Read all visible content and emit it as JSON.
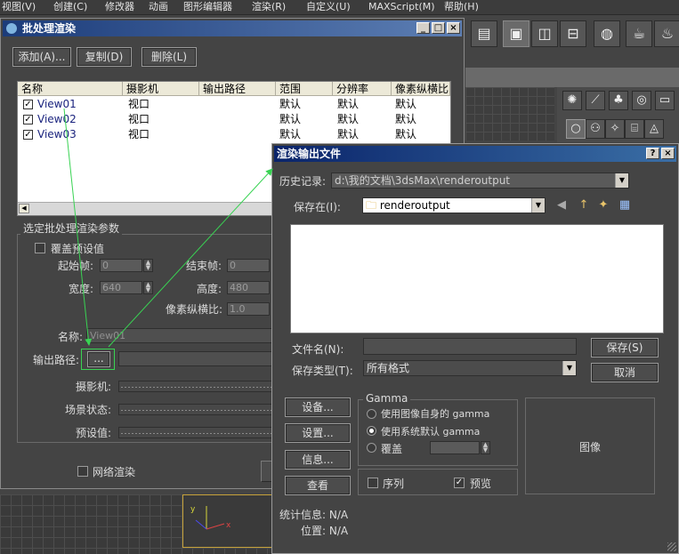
{
  "menubar": {
    "items": [
      "视图(V)",
      "创建(C)",
      "修改器",
      "动画",
      "图形编辑器",
      "渲染(R)",
      "自定义(U)",
      "MAXScript(M)",
      "帮助(H)"
    ]
  },
  "batch": {
    "title": "批处理渲染",
    "add_label": "添加(A)...",
    "copy_label": "复制(D)",
    "delete_label": "删除(L)",
    "columns": [
      "名称",
      "摄影机",
      "输出路径",
      "范围",
      "分辨率",
      "像素纵横比"
    ],
    "rows": [
      {
        "name": "View01",
        "camera": "视口",
        "path": "",
        "range": "默认",
        "resolution": "默认",
        "aspect": "默认"
      },
      {
        "name": "View02",
        "camera": "视口",
        "path": "",
        "range": "默认",
        "resolution": "默认",
        "aspect": "默认"
      },
      {
        "name": "View03",
        "camera": "视口",
        "path": "",
        "range": "默认",
        "resolution": "默认",
        "aspect": "默认"
      }
    ],
    "params_group": "选定批处理渲染参数",
    "override_label": "覆盖预设值",
    "start_frame_label": "起始帧:",
    "start_frame_value": "0",
    "end_frame_label": "结束帧:",
    "end_frame_value": "0",
    "width_label": "宽度:",
    "width_value": "640",
    "height_label": "高度:",
    "height_value": "480",
    "pixel_aspect_label": "像素纵横比:",
    "pixel_aspect_value": "1.0",
    "name_label": "名称:",
    "name_value": "View01",
    "output_path_label": "输出路径:",
    "browse_label": "...",
    "camera_label": "摄影机:",
    "scene_state_label": "场景状态:",
    "preset_label": "预设值:",
    "net_render_label": "网络渲染"
  },
  "output": {
    "title": "渲染输出文件",
    "help_btn": "?",
    "close_btn": "×",
    "history_label": "历史记录:",
    "history_value": "d:\\我的文档\\3dsMax\\renderoutput",
    "save_in_label": "保存在(I):",
    "save_in_value": "renderoutput",
    "filename_label": "文件名(N):",
    "filename_value": "",
    "filetype_label": "保存类型(T):",
    "filetype_value": "所有格式",
    "save_label": "保存(S)",
    "cancel_label": "取消",
    "devices_label": "设备...",
    "setup_label": "设置...",
    "info_label": "信息...",
    "view_label": "查看",
    "gamma_group": "Gamma",
    "gamma_opt1": "使用图像自身的 gamma",
    "gamma_opt2": "使用系统默认 gamma",
    "gamma_opt3": "覆盖",
    "sequence_label": "序列",
    "preview_label": "预览",
    "image_label": "图像",
    "stats_label": "统计信息: N/A",
    "location_label": "位置: N/A"
  },
  "colors": {
    "title_bar_start": "#0a246a",
    "title_bar_end": "#3a6ea5",
    "annotation_arrow": "#39d353"
  }
}
